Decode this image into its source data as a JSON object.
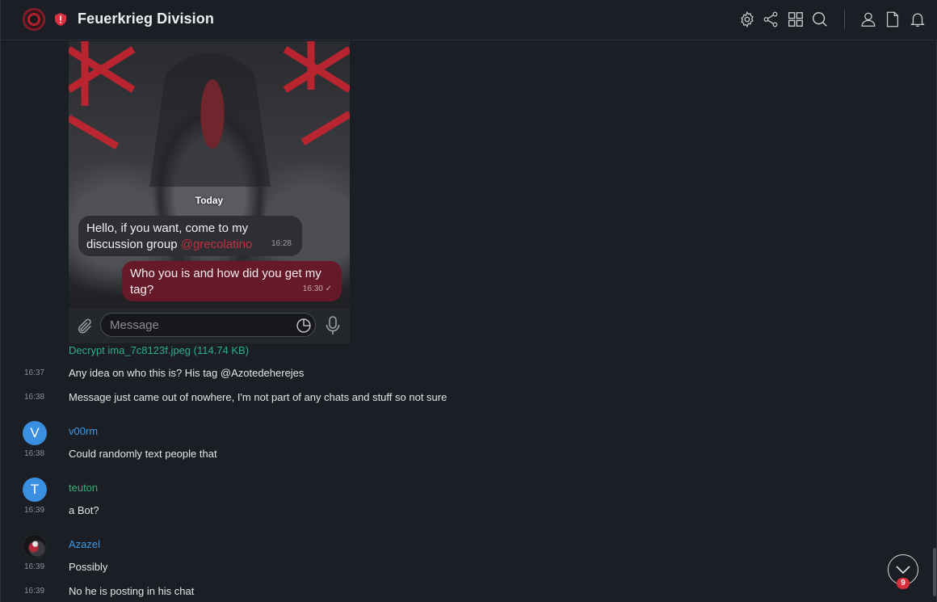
{
  "header": {
    "title": "Feuerkrieg Division",
    "icons": [
      "settings-icon",
      "share-icon",
      "grid-icon",
      "search-icon",
      "user-icon",
      "file-icon",
      "bell-icon"
    ]
  },
  "media": {
    "today_label": "Today",
    "incoming": {
      "text": "Hello, if you want, come to my discussion group ",
      "mention": "@grecolatino",
      "time": "16:28"
    },
    "outgoing": {
      "text": "Who you is and how did you get my tag?",
      "time": "16:30"
    },
    "composer_placeholder": "Message"
  },
  "decrypt_link": "Decrypt ima_7c8123f.jpeg (114.74 KB)",
  "messages": [
    {
      "time": "16:37",
      "text": "Any idea on who this is? His tag @Azotedeherejes"
    },
    {
      "time": "16:38",
      "text": "Message just came out of nowhere, I'm not part of any chats and stuff so not sure"
    },
    {
      "author": "v00rm",
      "avatar_letter": "V",
      "avatar_color": "#3b8fe0",
      "author_color": "#3b9ae8",
      "time": "16:38",
      "text": "Could randomly text people that"
    },
    {
      "author": "teuton",
      "avatar_letter": "T",
      "avatar_color": "#3b8fe0",
      "author_color": "#31b27d",
      "time": "16:39",
      "text": "a Bot?"
    },
    {
      "author": "Azazel",
      "author_color": "#3b9ae8",
      "time": "16:39",
      "text": "Possibly"
    },
    {
      "time": "16:39",
      "text": "No he is posting in his chat"
    }
  ],
  "unread_badge": "9",
  "colors": {
    "background": "#1b1e25",
    "accent_green": "#29b08a",
    "outgoing_bubble": "#661a29",
    "badge_red": "#d6303a"
  }
}
